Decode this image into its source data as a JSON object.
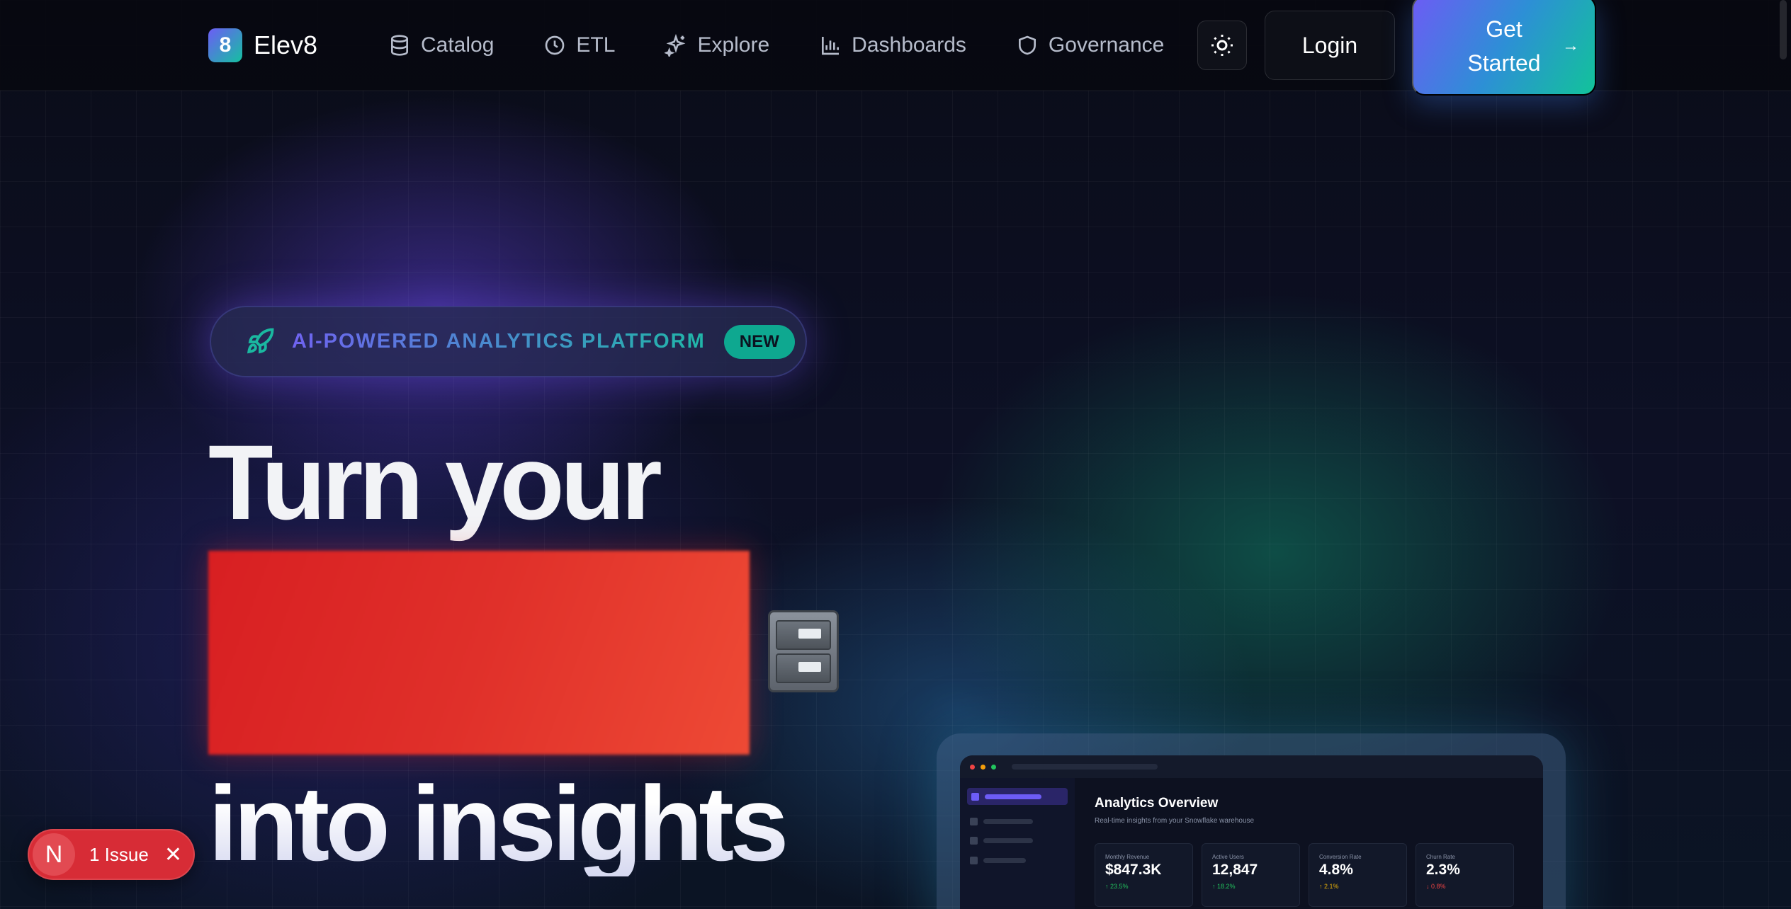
{
  "brand": {
    "name": "Elev8",
    "logo_glyph": "8",
    "icon": "brand-logo-icon"
  },
  "nav": {
    "items": [
      {
        "label": "Catalog",
        "icon": "database-icon"
      },
      {
        "label": "ETL",
        "icon": "clock-icon"
      },
      {
        "label": "Explore",
        "icon": "sparkles-icon"
      },
      {
        "label": "Dashboards",
        "icon": "bar-chart-icon"
      },
      {
        "label": "Governance",
        "icon": "shield-icon"
      }
    ],
    "theme_toggle_icon": "sun-icon",
    "login_label": "Login",
    "cta_label": "Get Started",
    "cta_arrow": "→"
  },
  "hero": {
    "badge_text": "AI-POWERED ANALYTICS PLATFORM",
    "badge_tag": "NEW",
    "badge_icon": "rocket-icon",
    "headline_line1": "Turn your",
    "headline_line3": "into insights",
    "emoji_icon": "file-cabinet-icon"
  },
  "preview": {
    "title": "Analytics Overview",
    "subtitle": "Real-time insights from your Snowflake warehouse",
    "kpis": [
      {
        "label": "Monthly Revenue",
        "value": "$847.3K",
        "delta": "↑ 23.5%",
        "color": "#22c55e"
      },
      {
        "label": "Active Users",
        "value": "12,847",
        "delta": "↑ 18.2%",
        "color": "#22c55e"
      },
      {
        "label": "Conversion Rate",
        "value": "4.8%",
        "delta": "↑ 2.1%",
        "color": "#eab308"
      },
      {
        "label": "Churn Rate",
        "value": "2.3%",
        "delta": "↓ 0.8%",
        "color": "#ef4444"
      }
    ]
  },
  "dev_overlay": {
    "badge_letter": "N",
    "issue_text": "1 Issue",
    "close_glyph": "✕"
  },
  "colors": {
    "accent_purple": "#6d5cf6",
    "accent_teal": "#12c39a",
    "issue_red": "#d72c36"
  }
}
